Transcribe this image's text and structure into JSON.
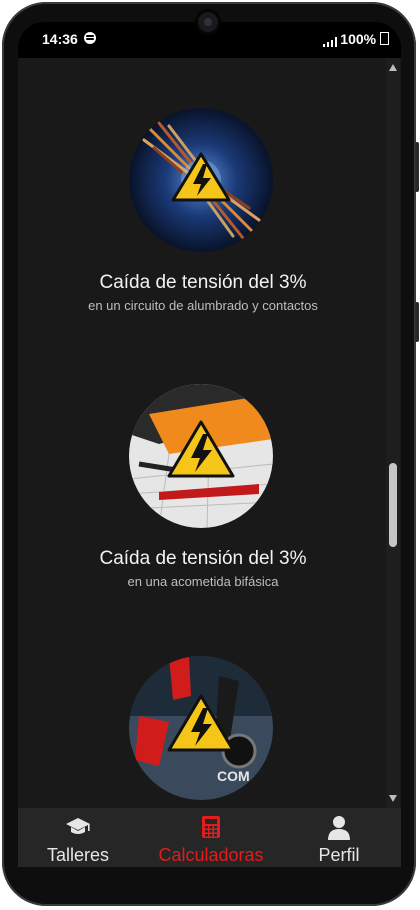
{
  "status_bar": {
    "time": "14:36",
    "battery": "100%"
  },
  "cards": [
    {
      "title": "Caída de tensión del 3%",
      "subtitle": "en un circuito de alumbrado y contactos"
    },
    {
      "title": "Caída de tensión del 3%",
      "subtitle": "en una acometida bifásica"
    },
    {
      "title": "",
      "subtitle": ""
    }
  ],
  "thumb_labels": {
    "meter_com": "COM"
  },
  "bottom_nav": {
    "items": [
      {
        "label": "Talleres",
        "icon": "graduation-cap-icon"
      },
      {
        "label": "Calculadoras",
        "icon": "calculator-icon"
      },
      {
        "label": "Perfil",
        "icon": "user-icon"
      }
    ],
    "active": "Calculadoras"
  },
  "colors": {
    "accent": "#e41c1c",
    "background": "#191919",
    "warning_yellow": "#f5c518"
  }
}
